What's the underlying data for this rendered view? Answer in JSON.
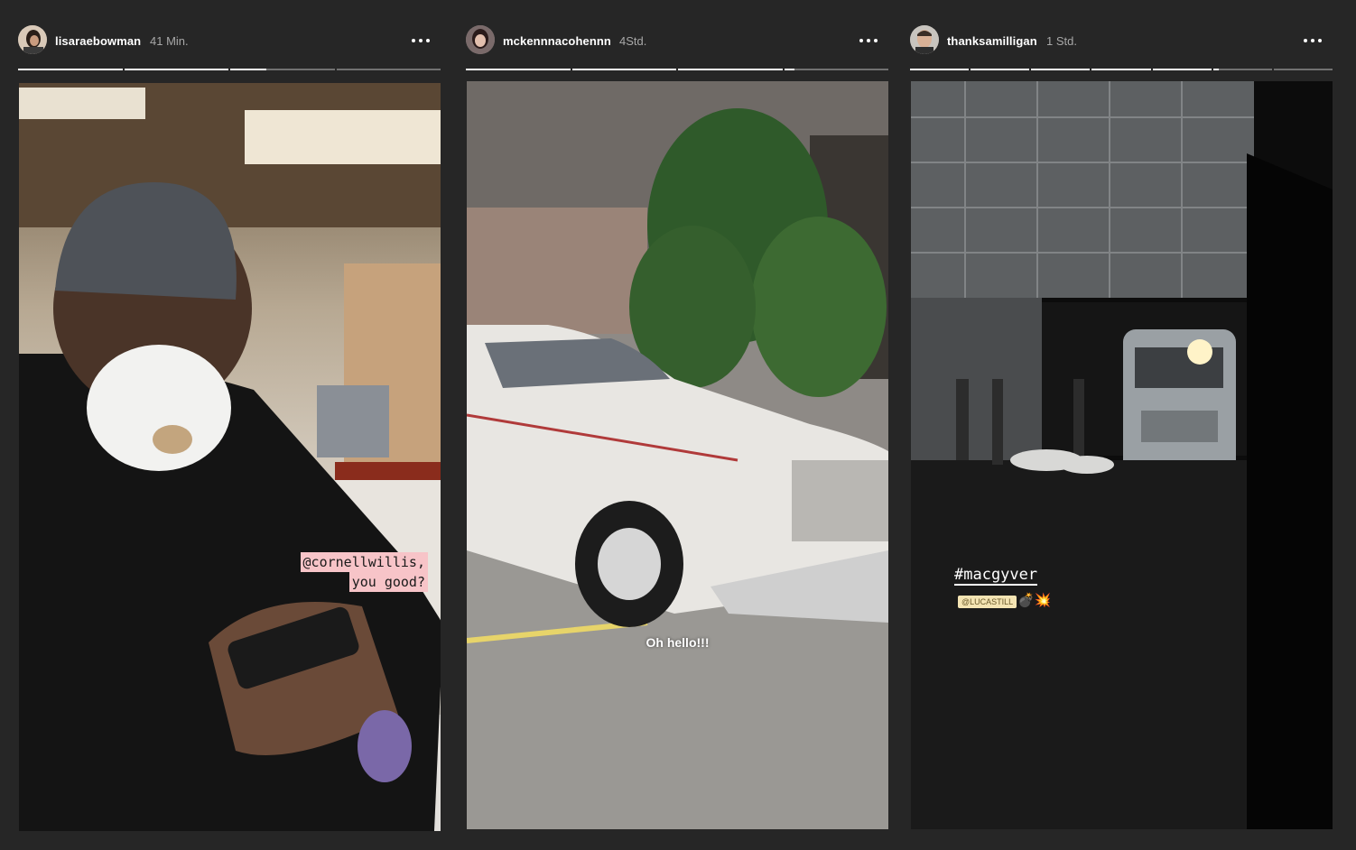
{
  "stories": [
    {
      "username": "lisaraebowman",
      "time": "41 Min.",
      "avatar_icon": "user-avatar",
      "progress": [
        1,
        1,
        0.35,
        0
      ],
      "mention_lines": [
        "@cornellwillis,",
        "you good?"
      ]
    },
    {
      "username": "mckennnacohennn",
      "time": "4Std.",
      "avatar_icon": "user-avatar",
      "progress": [
        1,
        1,
        1,
        0.1
      ],
      "caption": "Oh hello!!!"
    },
    {
      "username": "thanksamilligan",
      "time": "1 Std.",
      "avatar_icon": "user-avatar",
      "progress": [
        1,
        1,
        1,
        1,
        1,
        0.1,
        0
      ],
      "hashtag": "#macgyver",
      "mention": "@LUCASTILL",
      "emojis": "💣💥"
    }
  ],
  "colors": {
    "background": "#262626",
    "mention_sticker": "#f7c4c8",
    "progress_fill": "#ffffff"
  },
  "icons": {
    "more": "more-options-icon"
  }
}
